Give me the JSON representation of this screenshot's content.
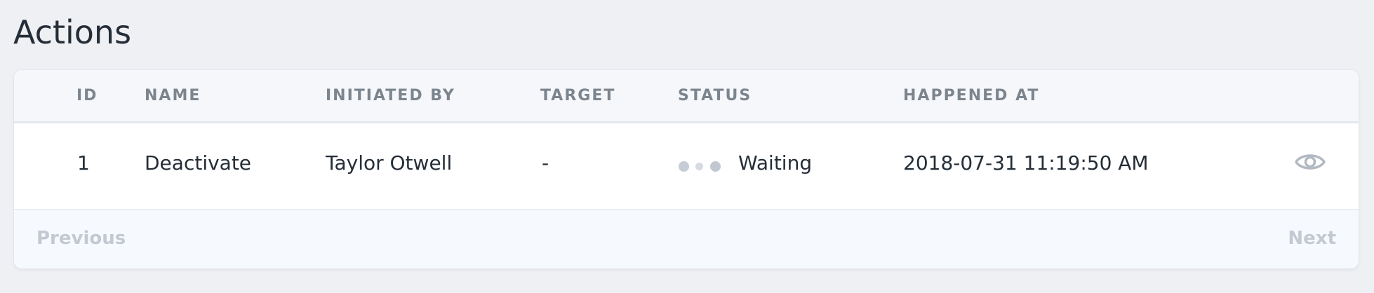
{
  "page": {
    "title": "Actions"
  },
  "table": {
    "columns": [
      "ID",
      "NAME",
      "INITIATED BY",
      "TARGET",
      "STATUS",
      "HAPPENED AT"
    ],
    "rows": [
      {
        "id": "1",
        "name": "Deactivate",
        "initiated_by": "Taylor Otwell",
        "target": "-",
        "status": "Waiting",
        "happened_at": "2018-07-31 11:19:50 AM",
        "action_icon": "eye-icon"
      }
    ]
  },
  "pagination": {
    "previous_label": "Previous",
    "next_label": "Next"
  },
  "colors": {
    "background": "#eff0f4",
    "header_text": "#7c858e",
    "body_text": "#252d37",
    "disabled_pager": "#c4c9d1",
    "status_dots": "#c7ccd6"
  }
}
